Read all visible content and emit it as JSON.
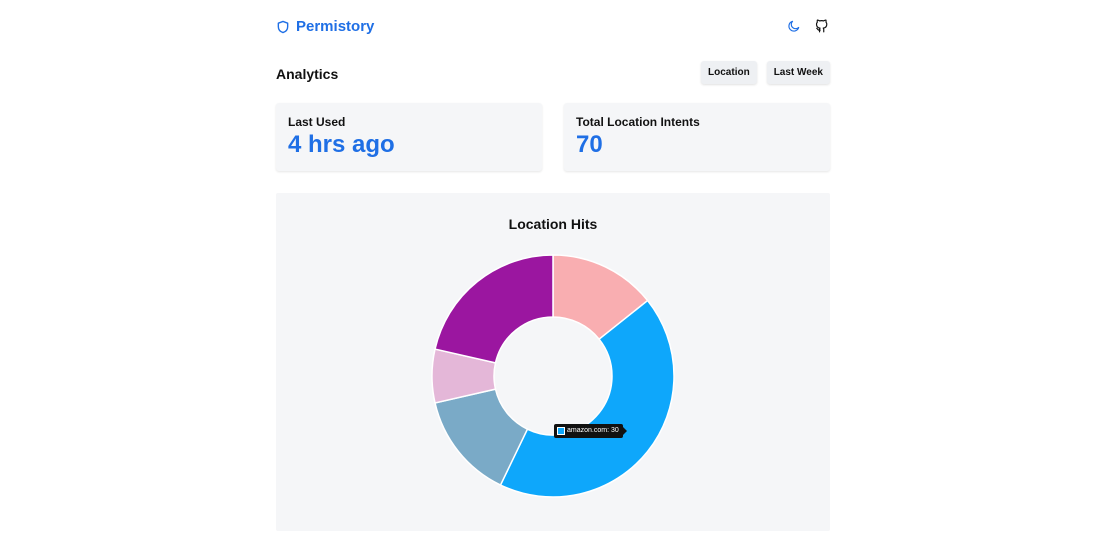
{
  "header": {
    "brand": "Permistory",
    "icons": [
      "shield-icon",
      "moon-icon",
      "github-icon"
    ],
    "accent": "#1f6fe5"
  },
  "analytics": {
    "title": "Analytics",
    "filters": [
      "Location",
      "Last Week"
    ]
  },
  "stats": [
    {
      "label": "Last Used",
      "value": "4 hrs ago"
    },
    {
      "label": "Total Location Intents",
      "value": "70"
    }
  ],
  "chart_data": {
    "type": "pie",
    "title": "Location Hits",
    "donut": true,
    "legend": "none",
    "slices": [
      {
        "value": 10,
        "color": "#f9aeb1"
      },
      {
        "label": "amazon.com",
        "value": 30,
        "color": "#0ea7fb"
      },
      {
        "value": 10,
        "color": "#7aaac7"
      },
      {
        "value": 5,
        "color": "#e4b7d8"
      },
      {
        "value": 15,
        "color": "#9b16a0"
      }
    ],
    "tooltip": {
      "text": "amazon.com: 30",
      "color": "#0ea7fb"
    }
  }
}
